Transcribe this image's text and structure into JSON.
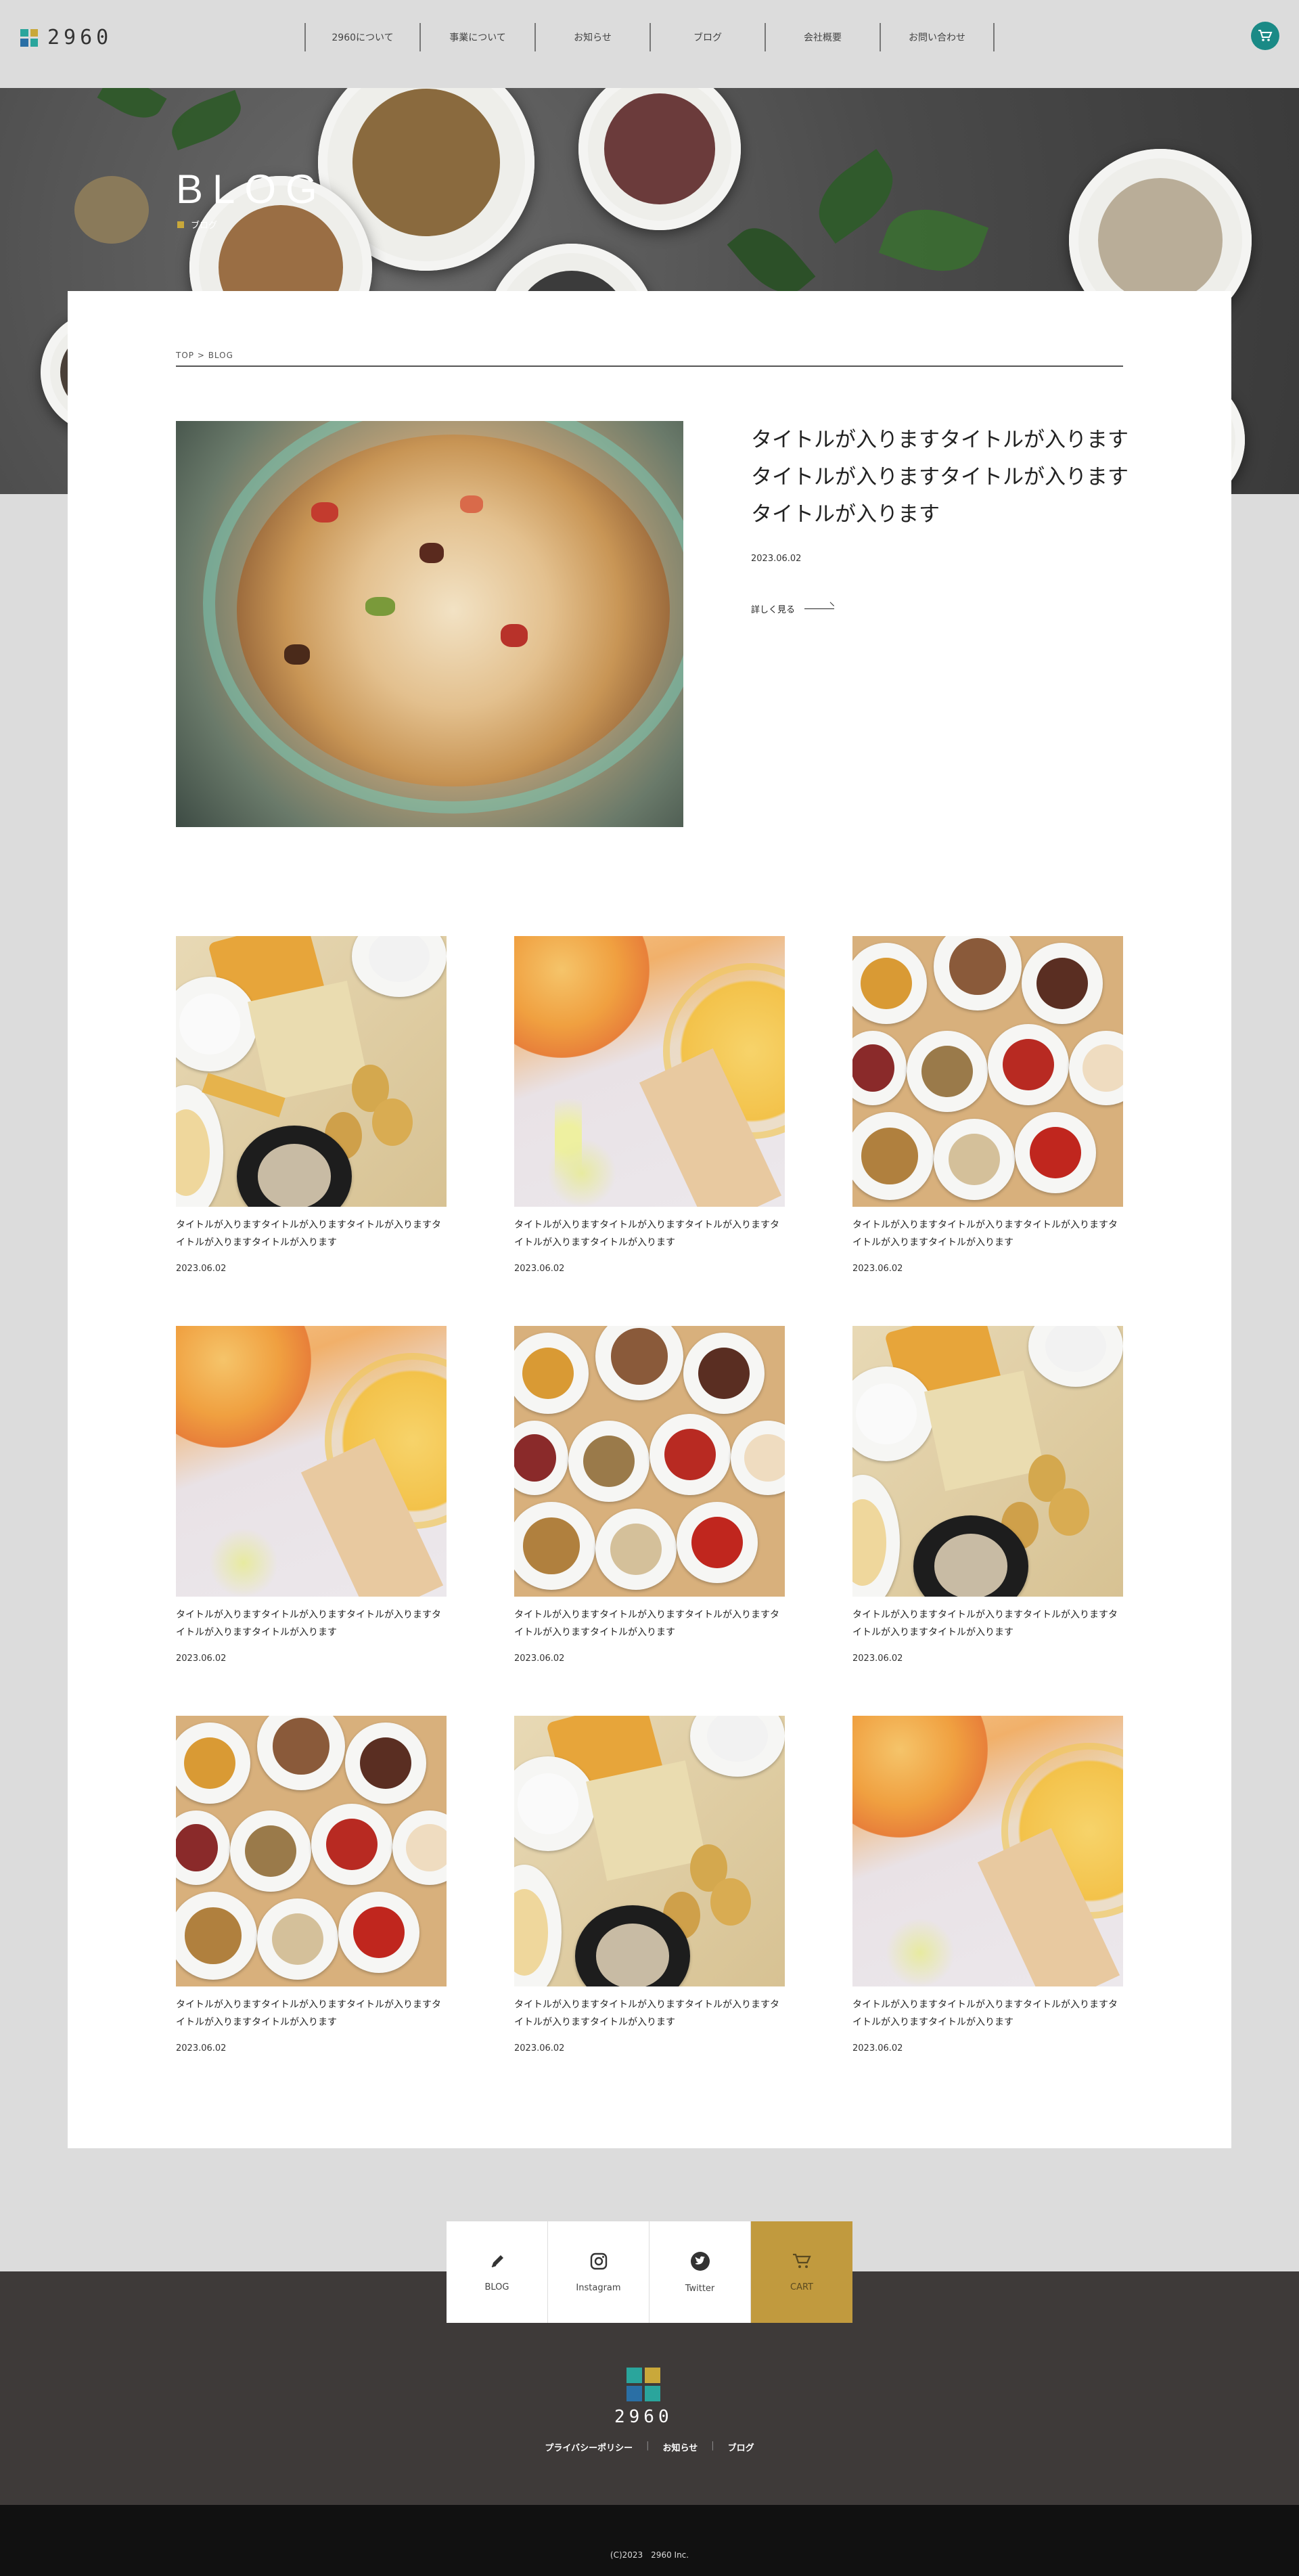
{
  "brand": {
    "name": "2960",
    "colors": {
      "teal": "#1a8a86",
      "gold": "#c19a3e",
      "footer": "#3e3a39"
    }
  },
  "nav": {
    "items": [
      {
        "label": "2960について"
      },
      {
        "label": "事業について"
      },
      {
        "label": "お知らせ"
      },
      {
        "label": "ブログ"
      },
      {
        "label": "会社概要"
      },
      {
        "label": "お問い合わせ"
      }
    ],
    "cart_icon": "cart-icon"
  },
  "hero": {
    "title": "BLOG",
    "subtitle": "ブログ"
  },
  "breadcrumb": {
    "text": "TOP > BLOG"
  },
  "featured": {
    "title": "タイトルが入りますタイトルが入りますタイトルが入りますタイトルが入りますタイトルが入ります",
    "date": "2023.06.02",
    "more_label": "詳しく見る"
  },
  "posts": [
    {
      "title": "タイトルが入りますタイトルが入りますタイトルが入りますタイトルが入りますタイトルが入ります",
      "date": "2023.06.02"
    },
    {
      "title": "タイトルが入りますタイトルが入りますタイトルが入りますタイトルが入りますタイトルが入ります",
      "date": "2023.06.02"
    },
    {
      "title": "タイトルが入りますタイトルが入りますタイトルが入りますタイトルが入りますタイトルが入ります",
      "date": "2023.06.02"
    },
    {
      "title": "タイトルが入りますタイトルが入りますタイトルが入りますタイトルが入りますタイトルが入ります",
      "date": "2023.06.02"
    },
    {
      "title": "タイトルが入りますタイトルが入りますタイトルが入りますタイトルが入りますタイトルが入ります",
      "date": "2023.06.02"
    },
    {
      "title": "タイトルが入りますタイトルが入りますタイトルが入りますタイトルが入りますタイトルが入ります",
      "date": "2023.06.02"
    },
    {
      "title": "タイトルが入りますタイトルが入りますタイトルが入りますタイトルが入りますタイトルが入ります",
      "date": "2023.06.02"
    },
    {
      "title": "タイトルが入りますタイトルが入りますタイトルが入りますタイトルが入りますタイトルが入ります",
      "date": "2023.06.02"
    },
    {
      "title": "タイトルが入りますタイトルが入りますタイトルが入りますタイトルが入りますタイトルが入ります",
      "date": "2023.06.02"
    }
  ],
  "footer": {
    "tabs": [
      {
        "label": "BLOG",
        "icon": "pencil-icon"
      },
      {
        "label": "Instagram",
        "icon": "instagram-icon"
      },
      {
        "label": "Twitter",
        "icon": "twitter-icon"
      },
      {
        "label": "CART",
        "icon": "cart-icon"
      }
    ],
    "links": [
      {
        "label": "プライバシーポリシー"
      },
      {
        "label": "お知らせ"
      },
      {
        "label": "ブログ"
      }
    ],
    "separator": "|",
    "copyright": "(C)2023　2960 Inc."
  }
}
